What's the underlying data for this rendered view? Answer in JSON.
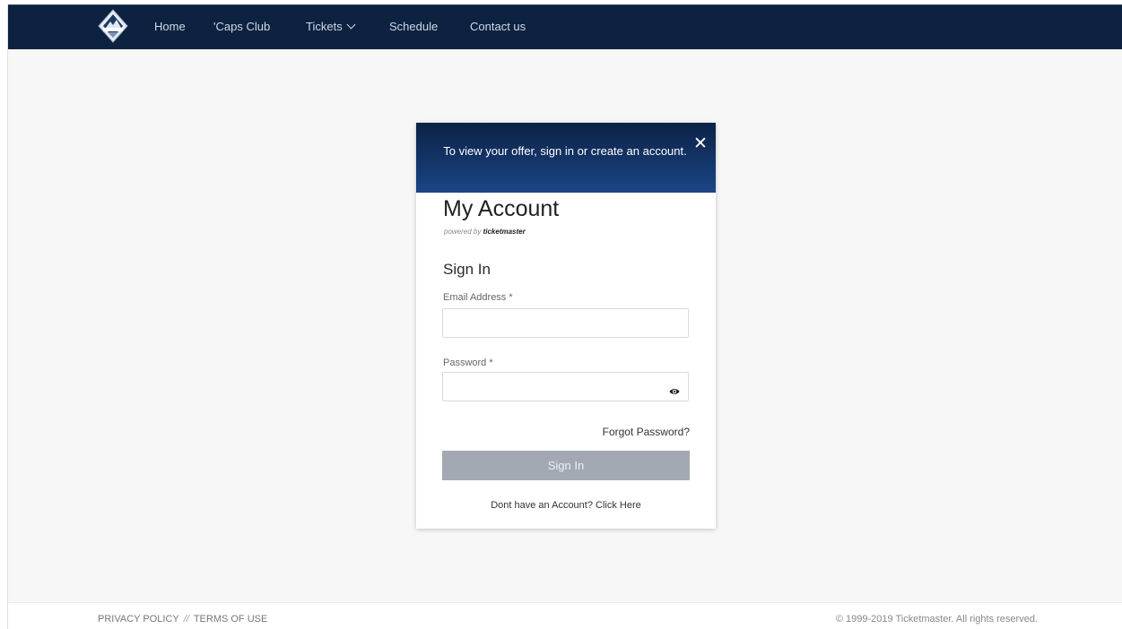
{
  "nav": {
    "items": [
      {
        "label": "Home"
      },
      {
        "label": "'Caps Club"
      },
      {
        "label": "Tickets"
      },
      {
        "label": "Schedule"
      },
      {
        "label": "Contact us"
      }
    ]
  },
  "modal": {
    "header_text": "To view your offer, sign in or create an account.",
    "close_label": "✕",
    "title": "My Account",
    "powered_prefix": "powered by",
    "powered_brand": "ticketmaster",
    "signin_heading": "Sign In",
    "email_label": "Email Address *",
    "email_value": "",
    "password_label": "Password *",
    "password_value": "",
    "forgot_label": "Forgot Password?",
    "signin_button": "Sign In",
    "register_text": "Dont have an Account? Click Here"
  },
  "footer": {
    "privacy": "PRIVACY POLICY",
    "separator": "//",
    "terms": "TERMS OF USE",
    "copyright": "© 1999-2019 Ticketmaster. All rights reserved."
  },
  "colors": {
    "navbar_bg": "#0d2240",
    "modal_header_bg": "#163a72",
    "signin_button_bg": "#a2a9b3",
    "page_bg": "#f7f7f7"
  },
  "icons": {
    "logo": "whitecaps-crest-logo",
    "close": "close-icon",
    "tickets_dropdown": "chevron-down-icon",
    "password_visibility": "eye-icon"
  }
}
